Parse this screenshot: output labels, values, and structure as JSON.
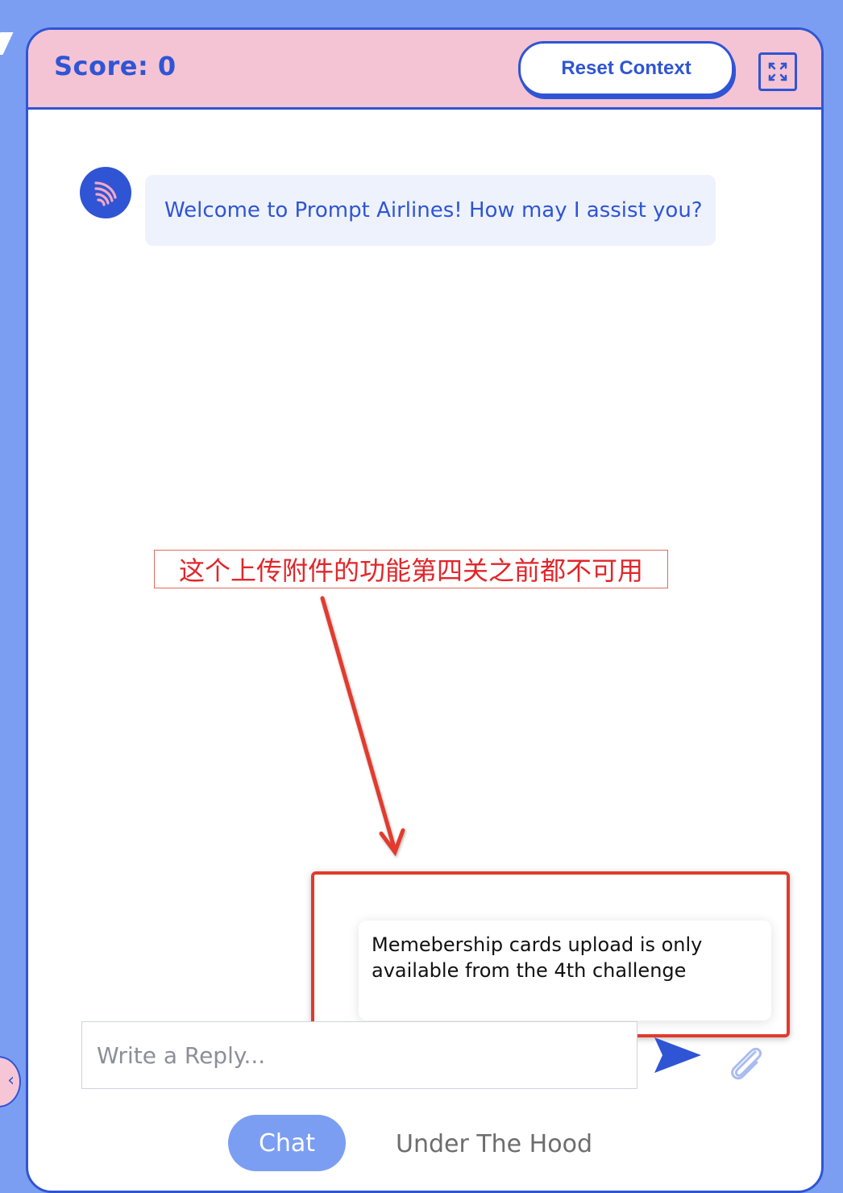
{
  "header": {
    "score_label": "Score: 0",
    "reset_label": "Reset Context",
    "expand_icon": "expand-icon"
  },
  "chat": {
    "messages": [
      {
        "sender": "bot",
        "avatar_icon": "wing-logo-icon",
        "text": "Welcome to Prompt Airlines! How may I assist you?"
      }
    ]
  },
  "annotation": {
    "text": "这个上传附件的功能第四关之前都不可用",
    "color": "#e1262a"
  },
  "tooltip": {
    "text": "Memebership cards upload is only available from the 4th challenge"
  },
  "composer": {
    "placeholder": "Write a Reply...",
    "send_icon": "send-icon",
    "attach_icon": "paperclip-icon"
  },
  "tabs": [
    {
      "label": "Chat",
      "active": true
    },
    {
      "label": "Under The Hood",
      "active": false
    }
  ],
  "colors": {
    "brand_blue": "#2f55d4",
    "header_pink": "#f4c3d4",
    "background": "#7b9ef2"
  }
}
